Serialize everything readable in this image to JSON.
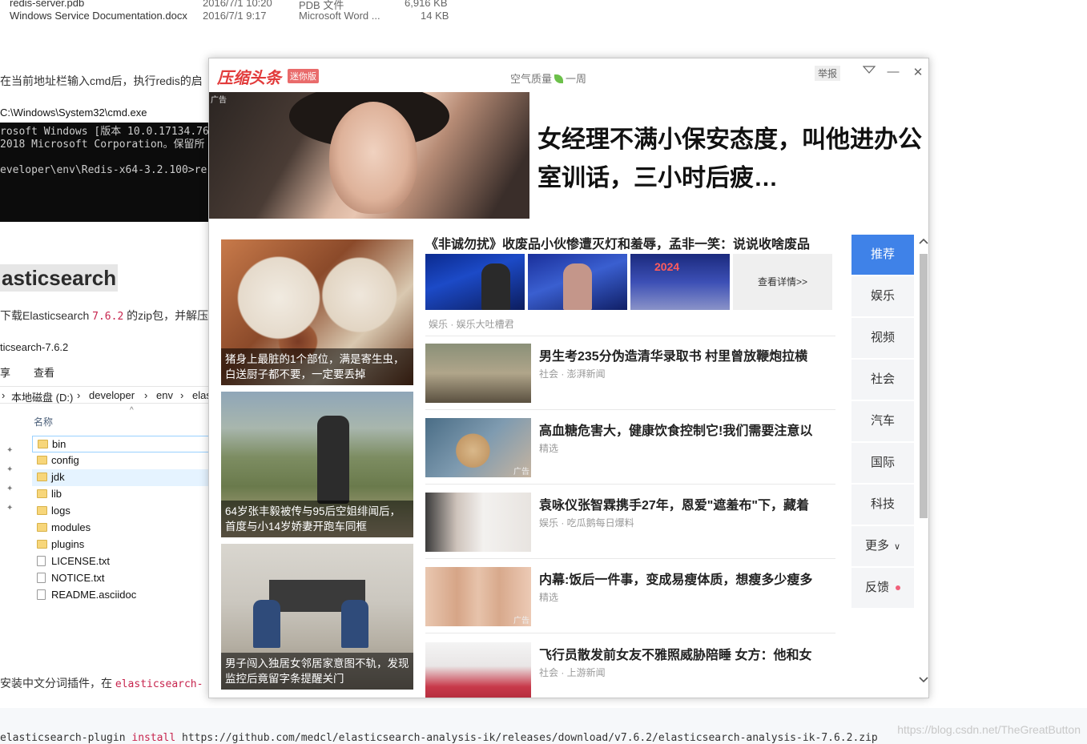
{
  "background": {
    "file_rows": [
      {
        "name": "redis-server.pdb",
        "date": "2016/7/1 10:20",
        "type": "PDB 文件",
        "size": "6,916 KB"
      },
      {
        "name": "Windows Service Documentation.docx",
        "date": "2016/7/1 9:17",
        "type": "Microsoft Word ...",
        "size": "14 KB"
      }
    ],
    "instruction_text": "在当前地址栏输入cmd后，执行redis的启",
    "cmd_title": "C:\\Windows\\System32\\cmd.exe",
    "console_lines": [
      "rosoft Windows [版本 10.0.17134.76",
      "2018 Microsoft Corporation。保留所",
      "",
      "eveloper\\env\\Redis-x64-3.2.100>re"
    ],
    "es_heading": "asticsearch",
    "download_text_prefix": "下载Elasticsearch ",
    "download_version": "7.6.2",
    "download_text_suffix": " 的zip包，并解压",
    "explorer": {
      "path": "ticsearch-7.6.2",
      "ribbon": [
        "享",
        "查看"
      ],
      "address": [
        "本地磁盘 (D:)",
        "developer",
        "env",
        "elas"
      ],
      "column_header": "名称",
      "items": [
        {
          "name": "bin",
          "kind": "folder"
        },
        {
          "name": "config",
          "kind": "folder"
        },
        {
          "name": "jdk",
          "kind": "folder"
        },
        {
          "name": "lib",
          "kind": "folder"
        },
        {
          "name": "logs",
          "kind": "folder"
        },
        {
          "name": "modules",
          "kind": "folder"
        },
        {
          "name": "plugins",
          "kind": "folder"
        },
        {
          "name": "LICENSE.txt",
          "kind": "file"
        },
        {
          "name": "NOTICE.txt",
          "kind": "file"
        },
        {
          "name": "README.asciidoc",
          "kind": "file"
        }
      ]
    },
    "plugin_text_prefix": "安装中文分词插件，在 ",
    "plugin_text_code": "elasticsearch-",
    "command_prefix": "elasticsearch-plugin ",
    "command_keyword": "install",
    "command_url": " https://github.com/medcl/elasticsearch-analysis-ik/releases/download/v7.6.2/elasticsearch-analysis-ik-7.6.2.zip",
    "watermark": "https://blog.csdn.net/TheGreatButton"
  },
  "popup": {
    "brand": "压缩头条",
    "brand_tag": "迷你版",
    "air_quality_label": "空气质量",
    "air_quality_value": "一周",
    "report_label": "举报",
    "hero": {
      "ad_label": "广告",
      "title": "女经理不满小保安态度，叫他进办公室训话，三小时后疲…"
    },
    "left_cards": [
      {
        "caption": "猪身上最脏的1个部位，满是寄生虫，白送厨子都不要，一定要丢掉"
      },
      {
        "caption": "64岁张丰毅被传与95后空姐绯闻后，首度与小14岁娇妻开跑车同框"
      },
      {
        "caption": "男子闯入独居女邻居家意图不轨，发现监控后竟留字条提醒关门"
      }
    ],
    "feature": {
      "title": "《非诚勿扰》收废品小伙惨遭灭灯和羞辱，孟非一笑：说说收啥废品",
      "thumb_number": "2024",
      "more_label": "查看详情>>",
      "meta": "娱乐 ·   娱乐大吐槽君"
    },
    "news": [
      {
        "title": "男生考235分伪造清华录取书 村里曾放鞭炮拉横",
        "meta": "社会 · 澎湃新闻",
        "ad": ""
      },
      {
        "title": "高血糖危害大，健康饮食控制它!我们需要注意以",
        "meta": "精选",
        "ad": "广告"
      },
      {
        "title": "袁咏仪张智霖携手27年，恩爱\"遮羞布\"下，藏着",
        "meta": "娱乐 · 吃瓜鹅每日爆料",
        "ad": ""
      },
      {
        "title": "内幕:饭后一件事，变成易瘦体质，想瘦多少瘦多",
        "meta": "精选",
        "ad": "广告"
      },
      {
        "title": "飞行员散发前女友不雅照威胁陪睡 女方：他和女",
        "meta": "社会 · 上游新闻",
        "ad": ""
      }
    ],
    "nav": [
      {
        "label": "推荐",
        "active": true
      },
      {
        "label": "娱乐"
      },
      {
        "label": "视频"
      },
      {
        "label": "社会"
      },
      {
        "label": "汽车"
      },
      {
        "label": "国际"
      },
      {
        "label": "科技"
      },
      {
        "label": "更多"
      },
      {
        "label": "反馈"
      }
    ],
    "colors": {
      "brand": "#e23b3b",
      "nav_active": "#3f82e8",
      "feedback_dot": "#f0607a"
    }
  }
}
